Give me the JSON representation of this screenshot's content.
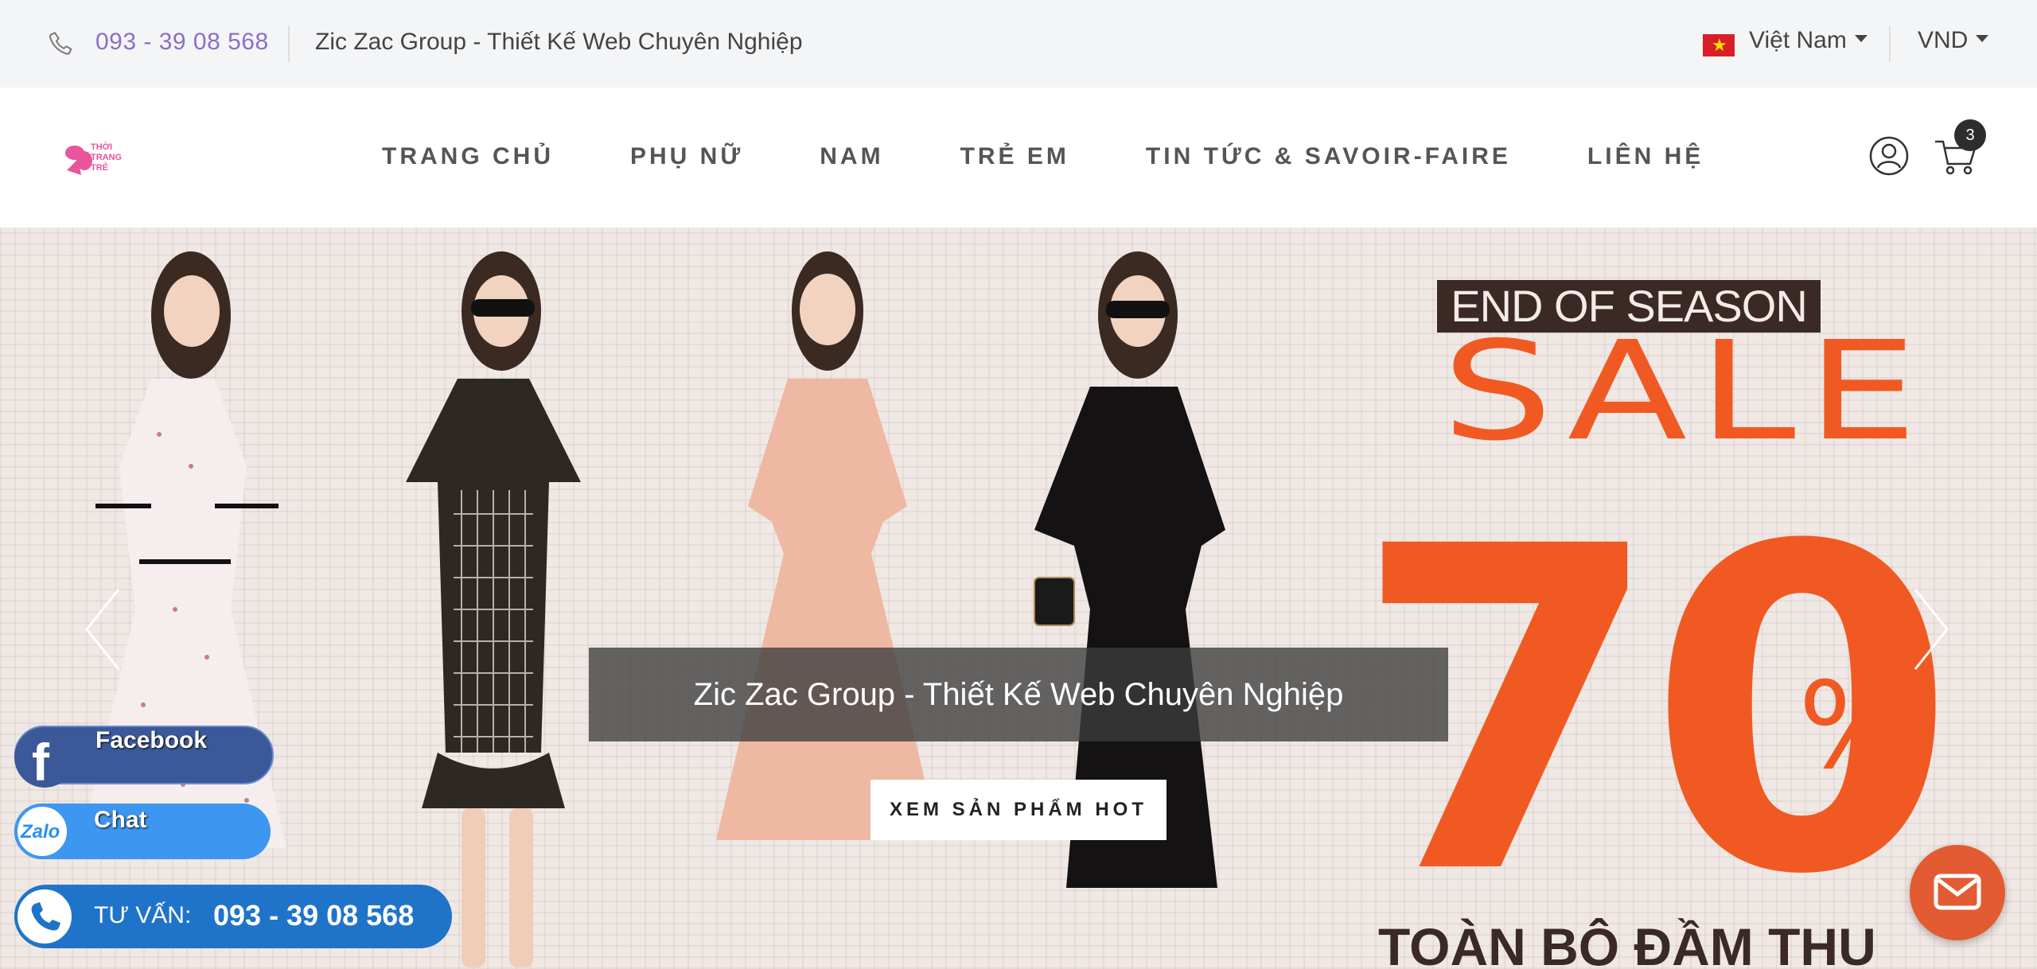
{
  "topbar": {
    "phone": "093 - 39 08 568",
    "company": "Zic Zac Group - Thiết Kế Web Chuyên Nghiệp",
    "language": "Việt Nam",
    "currency": "VND"
  },
  "header": {
    "logo_text": "THỜI TRANG TRẺ",
    "nav": [
      "TRANG CHỦ",
      "PHỤ NỮ",
      "NAM",
      "TRẺ EM",
      "TIN TỨC & SAVOIR-FAIRE",
      "LIÊN HỆ"
    ],
    "cart_count": "3"
  },
  "hero": {
    "banner_top": "END OF SEASON",
    "banner_sale": "SALE",
    "banner_percent_number": "70",
    "banner_percent_sign": "%",
    "banner_bottom": "TOÀN BỘ ĐẦM THU",
    "caption": "Zic Zac Group - Thiết Kế Web Chuyên Nghiệp",
    "cta": "XEM SẢN PHẨM HOT"
  },
  "contact": {
    "facebook": "Facebook",
    "zalo_icon_text": "Zalo",
    "zalo": "Chat",
    "call_label": "TƯ VẤN:",
    "call_number": "093 - 39 08 568"
  },
  "colors": {
    "accent": "#f05a22",
    "phone_text": "#8a6fc9",
    "facebook": "#3b5998",
    "zalo": "#3d96f0",
    "call": "#1f74c9",
    "mail": "#e35b32"
  },
  "icons": [
    "phone-icon",
    "vietnam-flag-icon",
    "chevron-down-icon",
    "user-icon",
    "cart-icon",
    "chevron-left-icon",
    "chevron-right-icon",
    "facebook-icon",
    "zalo-icon",
    "phone-icon",
    "mail-icon"
  ]
}
